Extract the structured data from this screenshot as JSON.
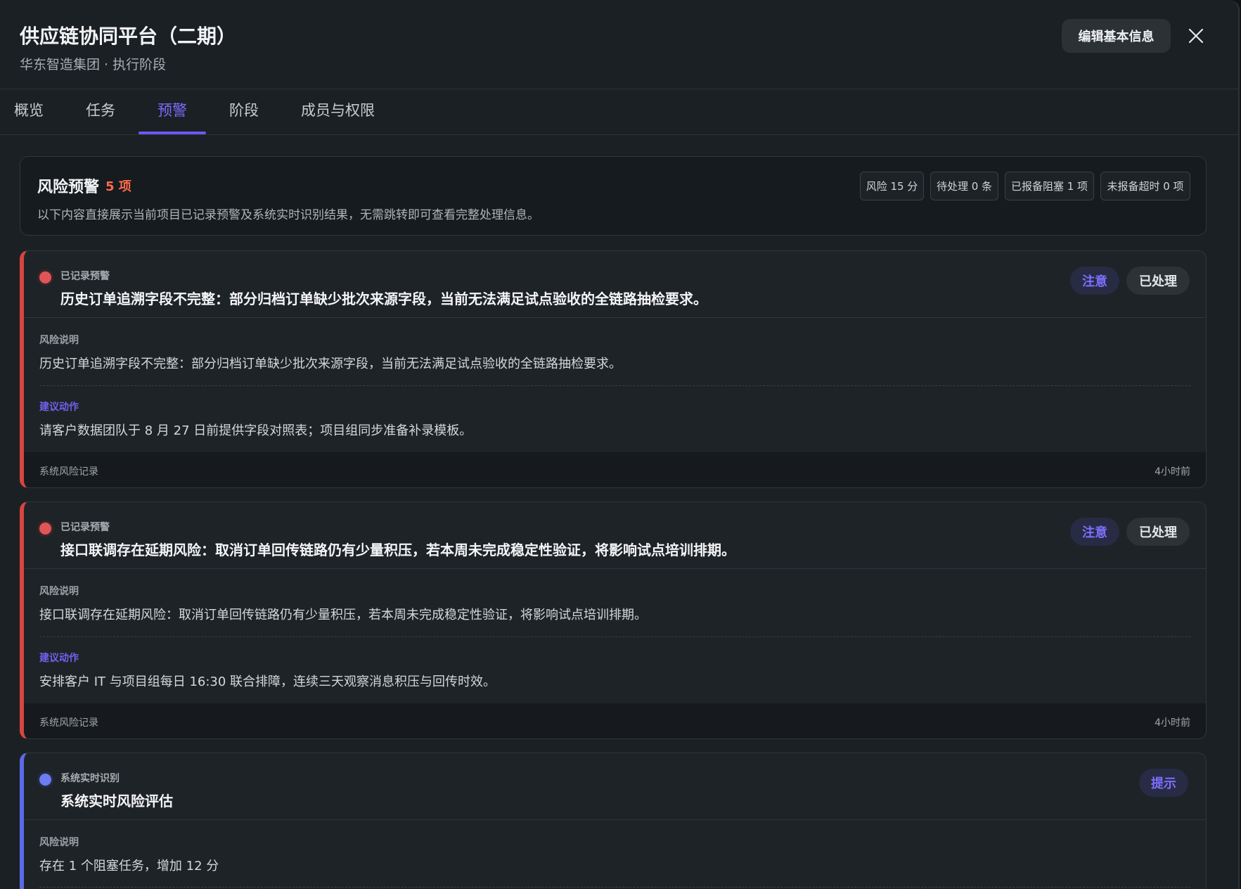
{
  "header": {
    "title": "供应链协同平台（二期）",
    "subtitle": "华东智造集团 · 执行阶段",
    "edit_label": "编辑基本信息"
  },
  "tabs": [
    {
      "label": "概览",
      "active": false
    },
    {
      "label": "任务",
      "active": false
    },
    {
      "label": "预警",
      "active": true
    },
    {
      "label": "阶段",
      "active": false
    },
    {
      "label": "成员与权限",
      "active": false
    }
  ],
  "summary": {
    "title": "风险预警",
    "count": "5 项",
    "description": "以下内容直接展示当前项目已记录预警及系统实时识别结果，无需跳转即可查看完整处理信息。",
    "stats": [
      "风险 15 分",
      "待处理 0 条",
      "已报备阻塞 1 项",
      "未报备超时 0 项"
    ]
  },
  "cards": [
    {
      "source": "已记录预警",
      "title": "历史订单追溯字段不完整：部分归档订单缺少批次来源字段，当前无法满足试点验收的全链路抽检要求。",
      "level": "注意",
      "status": "已处理",
      "risk_label": "风险说明",
      "risk_text": "历史订单追溯字段不完整：部分归档订单缺少批次来源字段，当前无法满足试点验收的全链路抽检要求。",
      "action_label": "建议动作",
      "action_text": "请客户数据团队于 8 月 27 日前提供字段对照表；项目组同步准备补录模板。",
      "footer_left": "系统风险记录",
      "footer_right": "4小时前"
    },
    {
      "source": "已记录预警",
      "title": "接口联调存在延期风险：取消订单回传链路仍有少量积压，若本周未完成稳定性验证，将影响试点培训排期。",
      "level": "注意",
      "status": "已处理",
      "risk_label": "风险说明",
      "risk_text": "接口联调存在延期风险：取消订单回传链路仍有少量积压，若本周未完成稳定性验证，将影响试点培训排期。",
      "action_label": "建议动作",
      "action_text": "安排客户 IT 与项目组每日 16:30 联合排障，连续三天观察消息积压与回传时效。",
      "footer_left": "系统风险记录",
      "footer_right": "4小时前"
    },
    {
      "source": "系统实时识别",
      "title": "系统实时风险评估",
      "level": "提示",
      "risk_label": "风险说明",
      "risk_text": "存在 1 个阻塞任务，增加 12 分"
    }
  ],
  "colors": {
    "accent": "#6a59f2",
    "danger": "#d6453f",
    "info": "#5b6ae8",
    "count": "#ff6b4a"
  }
}
